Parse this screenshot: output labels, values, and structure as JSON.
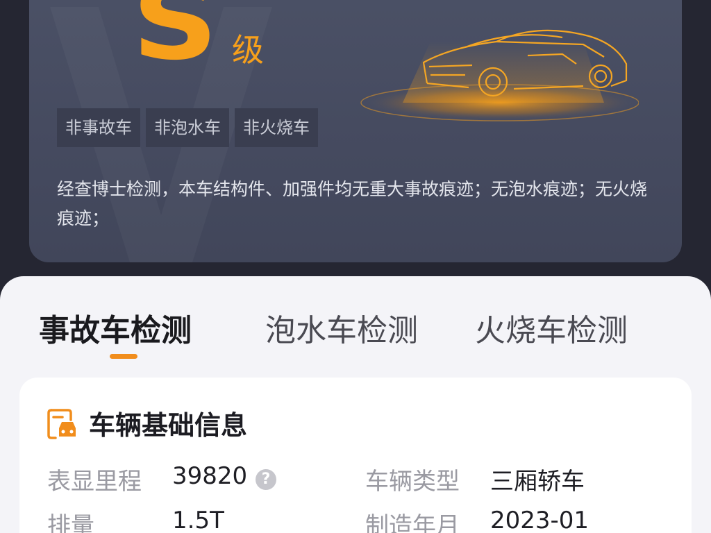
{
  "report": {
    "grade_letter": "S",
    "grade_suffix": "级",
    "tags": [
      "非事故车",
      "非泡水车",
      "非火烧车"
    ],
    "summary": "经查博士检测，本车结构件、加强件均无重大事故痕迹；无泡水痕迹；无火烧痕迹；",
    "accent_color": "#f7a01b",
    "car_icon": "sports-car-wireframe-illustration"
  },
  "tabs": [
    {
      "label": "事故车检测",
      "active": true
    },
    {
      "label": "泡水车检测",
      "active": false
    },
    {
      "label": "火烧车检测",
      "active": false
    }
  ],
  "basic_info": {
    "title": "车辆基础信息",
    "icon": "car-document-icon",
    "rows": [
      {
        "label_left": "表显里程",
        "value_left": "39820",
        "label_right": "车辆类型",
        "value_right": "三厢轿车"
      },
      {
        "label_left": "排量",
        "value_left": "1.5T",
        "label_right": "制造年月",
        "value_right": "2023-01"
      }
    ]
  }
}
